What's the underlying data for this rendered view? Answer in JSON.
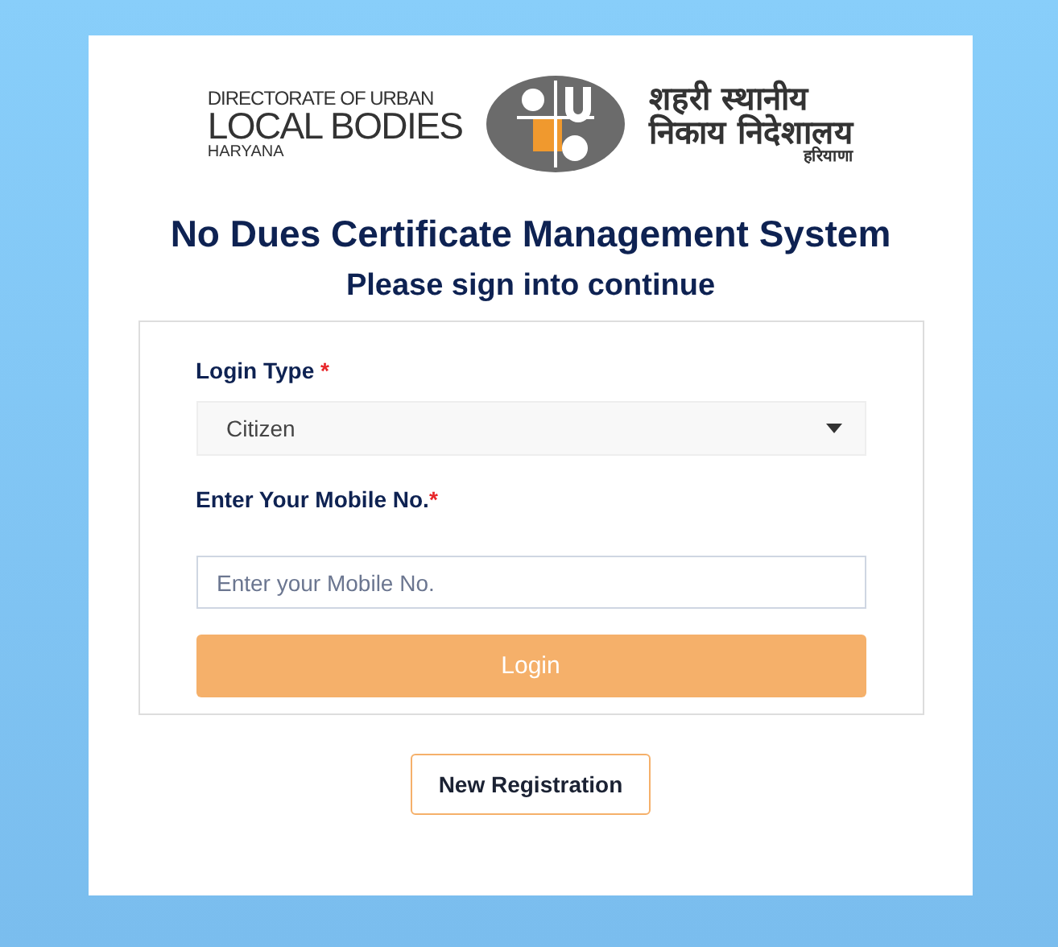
{
  "logo": {
    "english_lines": [
      "DIRECTORATE OF URBAN",
      "LOCAL BODIES",
      "HARYANA"
    ],
    "hindi_lines": [
      "शहरी स्थानीय",
      "निकाय निदेशालय",
      "हरियाणा"
    ]
  },
  "title": "No Dues Certificate Management System",
  "subtitle": "Please sign into continue",
  "form": {
    "fields": [
      {
        "kind": "select",
        "label": "Login Type ",
        "required_mark": "*",
        "value": "Citizen"
      },
      {
        "kind": "input",
        "label": "Enter Your Mobile No.",
        "required_mark": "*",
        "placeholder": "Enter your Mobile No."
      }
    ],
    "submit": "Login"
  },
  "secondary_button": "New Registration"
}
